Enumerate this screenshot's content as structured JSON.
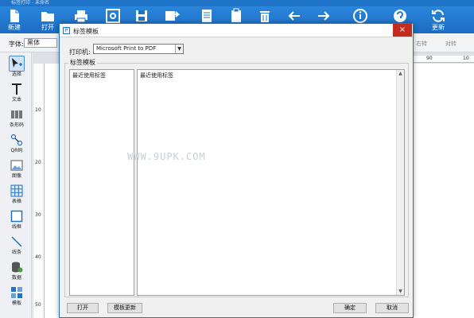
{
  "app": {
    "title": "标签打印 - 未命名"
  },
  "ribbon": {
    "new_label": "新建",
    "open_label": "打开",
    "update_label": "更新",
    "buttons": [
      "print-icon",
      "at-sign-icon",
      "save-icon",
      "save-as-icon",
      "document-icon",
      "clipboard-icon",
      "trash-icon",
      "arrow-left-icon",
      "arrow-right-icon",
      "info-icon",
      "help-icon",
      "refresh-icon"
    ]
  },
  "fontbar": {
    "font_label": "字体:",
    "font_value": "黑体",
    "right_align": "右转",
    "align_center": "对转"
  },
  "left_tools": [
    {
      "label": "选择",
      "icon": "select-cursor-icon"
    },
    {
      "label": "文本",
      "icon": "text-icon"
    },
    {
      "label": "条形码",
      "icon": "barcode-icon"
    },
    {
      "label": "QR码",
      "icon": "qr-code-icon"
    },
    {
      "label": "图像",
      "icon": "image-icon"
    },
    {
      "label": "表格",
      "icon": "table-icon"
    },
    {
      "label": "线框",
      "icon": "rectangle-icon"
    },
    {
      "label": "线条",
      "icon": "line-icon"
    },
    {
      "label": "数据",
      "icon": "database-icon"
    },
    {
      "label": "模板",
      "icon": "template-icon"
    }
  ],
  "rulers": {
    "top": [
      "90",
      "10"
    ],
    "left": [
      "10",
      "20",
      "30",
      "40",
      "50"
    ]
  },
  "dialog": {
    "title": "标签模板",
    "printer_label": "打印机:",
    "printer_value": "Microsoft Print to PDF",
    "group_label": "标签模板",
    "recent_header": "最近使用标签",
    "template_header": "最近使用标签",
    "buttons": {
      "open": "打开",
      "update": "模板更新",
      "ok": "确定",
      "cancel": "取消"
    },
    "close_glyph": "×"
  },
  "watermark": "WWW.9UPK.COM",
  "colors": {
    "ribbon": "#1f74c8",
    "close": "#c42b1c"
  }
}
